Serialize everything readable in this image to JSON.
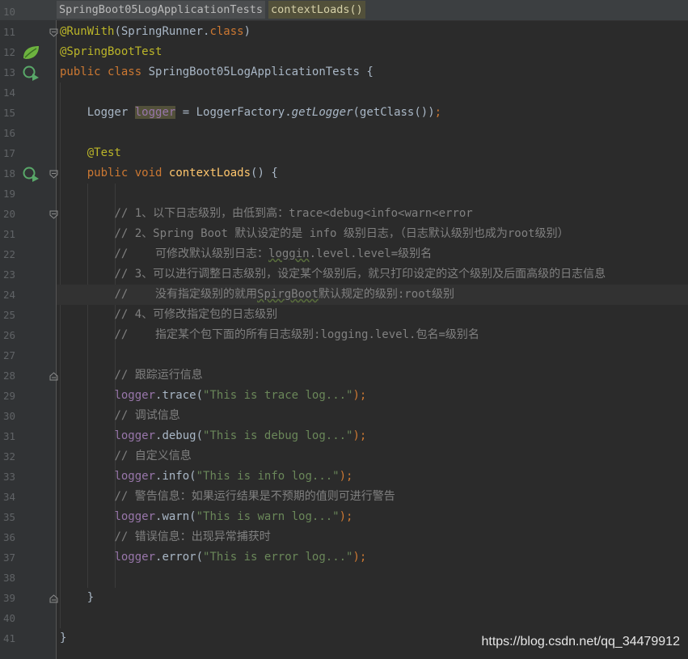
{
  "breadcrumb": {
    "class_name": "SpringBoot05LogApplicationTests",
    "method_name": "contextLoads()"
  },
  "editor": {
    "line_numbers": [
      "10",
      "11",
      "12",
      "13",
      "14",
      "15",
      "16",
      "17",
      "18",
      "19",
      "20",
      "21",
      "22",
      "23",
      "24",
      "25",
      "26",
      "27",
      "28",
      "29",
      "30",
      "31",
      "32",
      "33",
      "34",
      "35",
      "36",
      "37",
      "38",
      "39",
      "40",
      "41"
    ],
    "caret_line": "24",
    "gutter_icons": [
      {
        "line": "12",
        "icon": "spring-leaf-icon"
      },
      {
        "line": "13",
        "icon": "run-test-icon"
      },
      {
        "line": "18",
        "icon": "run-test-icon"
      }
    ],
    "fold_markers": [
      "11",
      "18",
      "20",
      "28",
      "39"
    ],
    "lines": {
      "l11": {
        "ann": "@RunWith",
        "p1": "(SpringRunner.",
        "kw": "class",
        "p2": ")"
      },
      "l12": {
        "ann": "@SpringBootTest"
      },
      "l13": {
        "kw1": "public",
        "kw2": "class",
        "name": "SpringBoot05LogApplicationTests",
        "brace": "{"
      },
      "l15": {
        "type": "Logger",
        "field": "logger",
        "eq": "=",
        "factory": "LoggerFactory.",
        "method": "getLogger",
        "args": "(getClass())",
        "semi": ";"
      },
      "l17": {
        "ann": "@Test"
      },
      "l18": {
        "kw1": "public",
        "kw2": "void",
        "method": "contextLoads",
        "rest": "() {"
      },
      "l20": {
        "text": "// 1、以下日志级别，由低到高：trace<debug<info<warn<error"
      },
      "l21": {
        "text": "// 2、Spring Boot 默认设定的是 info 级别日志，（日志默认级别也成为root级别）"
      },
      "l22": {
        "prefix": "//    可修改默认级别日志：",
        "squiggle": "loggin",
        "suffix": ".level.level=级别名"
      },
      "l23": {
        "text": "// 3、可以进行调整日志级别，设定某个级别后，就只打印设定的这个级别及后面高级的日志信息"
      },
      "l24": {
        "prefix": "//    没有指定级别的就用",
        "squiggle": "SpirgBoot",
        "suffix": "默认规定的级别:root级别"
      },
      "l25": {
        "text": "// 4、可修改指定包的日志级别"
      },
      "l26": {
        "text": "//    指定某个包下面的所有日志级别:logging.level.包名=级别名"
      },
      "l28": {
        "text": "// 跟踪运行信息"
      },
      "l29": {
        "field": "logger",
        "method": "trace",
        "open": "(",
        "str": "\"This is trace log...\"",
        "close": ");"
      },
      "l30": {
        "text": "// 调试信息"
      },
      "l31": {
        "field": "logger",
        "method": "debug",
        "open": "(",
        "str": "\"This is debug log...\"",
        "close": ");"
      },
      "l32": {
        "text": "// 自定义信息"
      },
      "l33": {
        "field": "logger",
        "method": "info",
        "open": "(",
        "str": "\"This is info log...\"",
        "close": ");"
      },
      "l34": {
        "text": "// 警告信息：如果运行结果是不预期的值则可进行警告"
      },
      "l35": {
        "field": "logger",
        "method": "warn",
        "open": "(",
        "str": "\"This is warn log...\"",
        "close": ");"
      },
      "l36": {
        "text": "// 错误信息：出现异常捕获时"
      },
      "l37": {
        "field": "logger",
        "method": "error",
        "open": "(",
        "str": "\"This is error log...\"",
        "close": ");"
      },
      "l39": {
        "text": "}"
      },
      "l41": {
        "text": "}"
      }
    }
  },
  "watermark": "https://blog.csdn.net/qq_34479912",
  "colors": {
    "background": "#2b2b2b",
    "gutter": "#313335",
    "keyword": "#cc7832",
    "annotation": "#bbb529",
    "comment": "#808080",
    "string": "#6a8759",
    "field": "#9876aa",
    "method": "#ffc66d",
    "text": "#a9b7c6"
  }
}
